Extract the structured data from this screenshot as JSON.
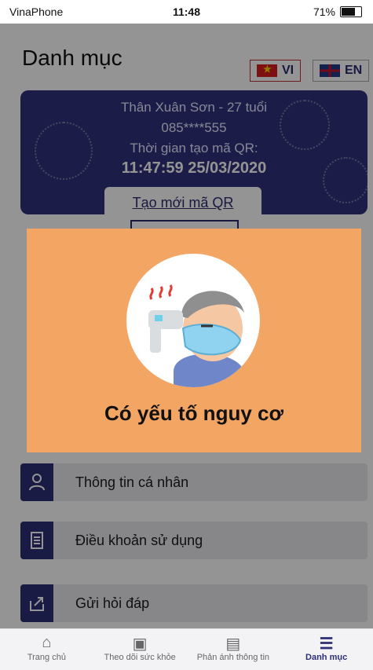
{
  "status_bar": {
    "carrier": "VinaPhone",
    "time": "11:48",
    "battery": "71%"
  },
  "header": {
    "title": "Danh mục"
  },
  "language": {
    "vi": "VI",
    "en": "EN"
  },
  "qr_card": {
    "name_age": "Thân Xuân Sơn - 27 tuổi",
    "phone": "085****555",
    "created_label": "Thời gian tạo mã QR:",
    "created_time": "11:47:59 25/03/2020",
    "new_qr_link": "Tạo mới mã QR"
  },
  "menu": [
    {
      "label": "Thông tin cá nhân",
      "icon": "person-icon"
    },
    {
      "label": "Điều khoản sử dụng",
      "icon": "document-icon"
    },
    {
      "label": "Gửi hỏi đáp",
      "icon": "share-icon"
    }
  ],
  "tabs": [
    {
      "label": "Trang chủ",
      "icon": "home-icon"
    },
    {
      "label": "Theo dõi sức khỏe",
      "icon": "image-icon"
    },
    {
      "label": "Phản ánh thông tin",
      "icon": "message-icon"
    },
    {
      "label": "Danh mục",
      "icon": "menu-icon"
    }
  ],
  "modal": {
    "title": "Có yếu tố nguy cơ"
  },
  "colors": {
    "navy": "#30337c",
    "modal_bg": "#f3a563"
  }
}
